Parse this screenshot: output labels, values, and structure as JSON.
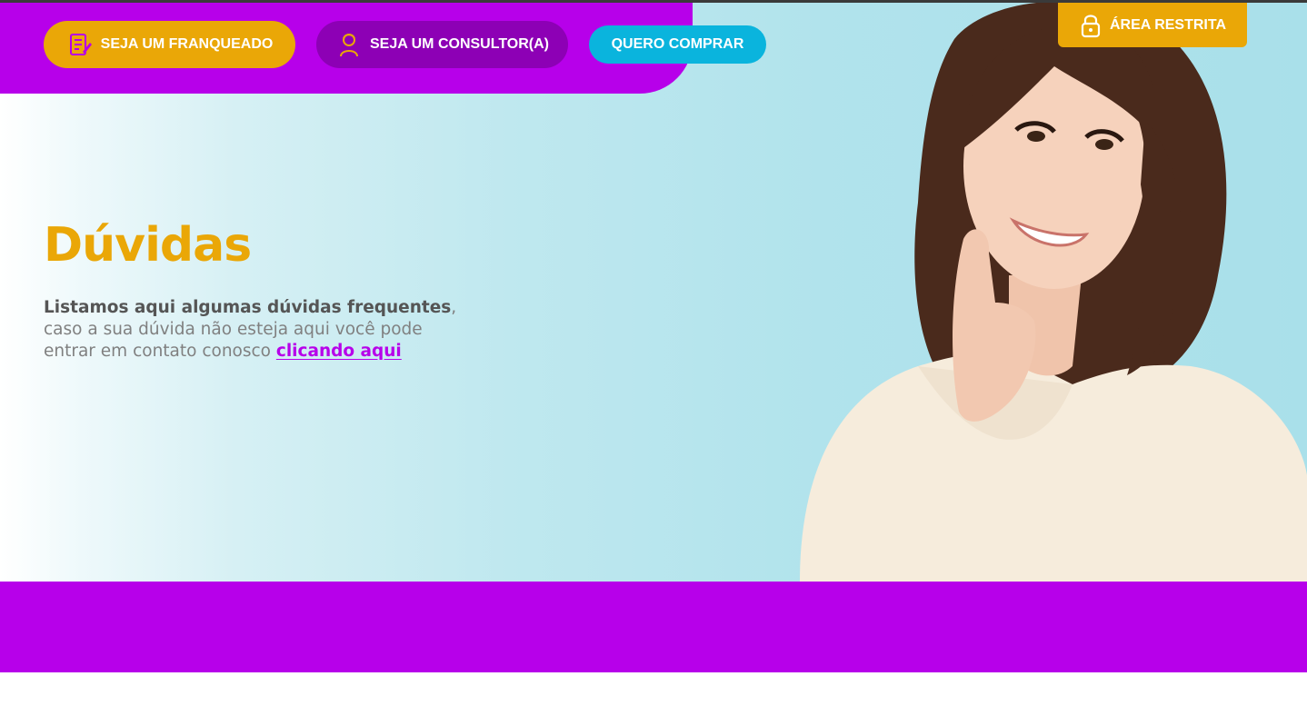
{
  "header": {
    "buttons": [
      {
        "label": "SEJA UM FRANQUEADO",
        "icon": "form-edit-icon"
      },
      {
        "label": "SEJA UM CONSULTOR(A)",
        "icon": "consultant-person-icon"
      },
      {
        "label": "QUERO COMPRAR"
      }
    ],
    "restricted": {
      "label": "ÁREA RESTRITA",
      "icon": "padlock-icon"
    }
  },
  "hero": {
    "title": "Dúvidas",
    "description_strong": "Listamos aqui algumas dúvidas frequentes",
    "description_comma": ",",
    "description_rest": " caso a sua dúvida não esteja aqui você pode entrar em contato conosco ",
    "link_label": "clicando aqui",
    "image_subject": "smiling woman thinking with hand on chin"
  },
  "colors": {
    "purple": "#b700ea",
    "dark_purple": "#8d00b5",
    "gold": "#eaa707",
    "cyan": "#0ab4dd",
    "text_gray": "#808080"
  }
}
